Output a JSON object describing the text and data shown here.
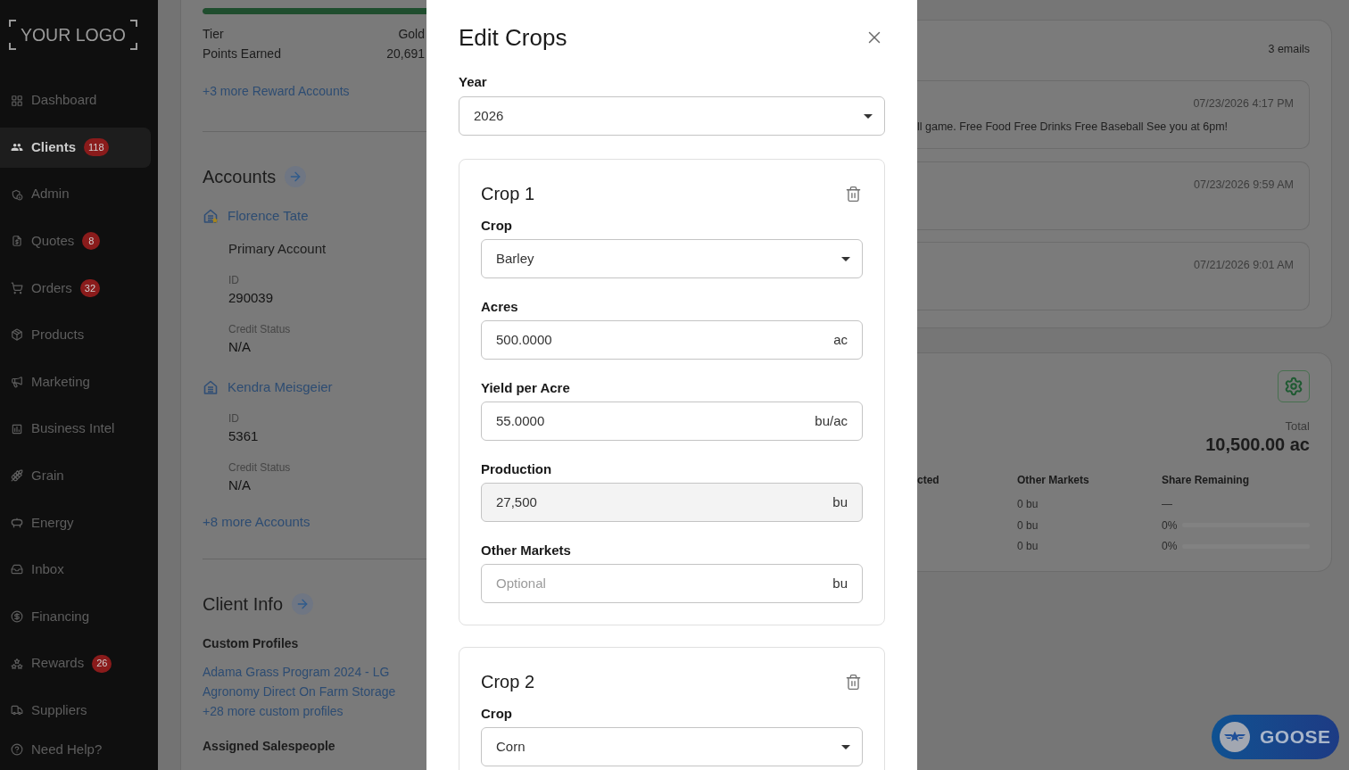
{
  "sidebar": {
    "logo": "YOUR LOGO",
    "items": [
      {
        "label": "Dashboard",
        "selected": false
      },
      {
        "label": "Clients",
        "selected": true,
        "badge": "118"
      },
      {
        "label": "Admin",
        "selected": false
      },
      {
        "label": "Quotes",
        "selected": false,
        "badge": "8"
      },
      {
        "label": "Orders",
        "selected": false,
        "badge": "32"
      },
      {
        "label": "Products",
        "selected": false
      },
      {
        "label": "Marketing",
        "selected": false
      },
      {
        "label": "Business Intel",
        "selected": false
      },
      {
        "label": "Grain",
        "selected": false
      },
      {
        "label": "Energy",
        "selected": false
      },
      {
        "label": "Inbox",
        "selected": false
      },
      {
        "label": "Financing",
        "selected": false
      },
      {
        "label": "Rewards",
        "selected": false,
        "badge": "26"
      },
      {
        "label": "Suppliers",
        "selected": false
      },
      {
        "label": "Need Help?",
        "selected": false
      }
    ]
  },
  "rewards": {
    "progress": {
      "level": 1
    },
    "rows": [
      {
        "label": "Tier",
        "value": "Gold"
      },
      {
        "label": "Points Earned",
        "value": "20,691"
      }
    ],
    "more_link": "+3 more Reward Accounts"
  },
  "accounts": {
    "title": "Accounts",
    "items": [
      {
        "name": "Florence Tate",
        "primary": true,
        "note": "Primary Account",
        "fields": [
          {
            "label": "ID",
            "value": "290039"
          },
          {
            "label": "Credit Status",
            "value": "N/A"
          }
        ]
      },
      {
        "name": "Kendra Meisgeier",
        "primary": false,
        "fields": [
          {
            "label": "ID",
            "value": "5361"
          },
          {
            "label": "Credit Status",
            "value": "N/A"
          }
        ]
      }
    ],
    "more_link": "+8 more Accounts"
  },
  "client_info": {
    "title": "Client Info",
    "custom_profiles": {
      "heading": "Custom Profiles",
      "links": [
        "Adama Grass Program 2024 - LG",
        "Agronomy Direct On Farm Storage",
        "+28 more custom profiles"
      ]
    },
    "assigned_salespeople": {
      "heading": "Assigned Salespeople"
    }
  },
  "modal": {
    "title": "Edit Crops",
    "year": {
      "label": "Year",
      "value": "2026"
    },
    "crops": [
      {
        "title": "Crop 1",
        "fields": [
          {
            "kind": "select",
            "label": "Crop",
            "value": "Barley",
            "disabled": false
          },
          {
            "kind": "input",
            "label": "Acres",
            "value": "500.0000",
            "unit": "ac",
            "disabled": false
          },
          {
            "kind": "input",
            "label": "Yield per Acre",
            "value": "55.0000",
            "unit": "bu/ac",
            "disabled": false
          },
          {
            "kind": "input",
            "label": "Production",
            "value": "27,500",
            "unit": "bu",
            "disabled": true
          },
          {
            "kind": "input",
            "label": "Other Markets",
            "placeholder": "Optional",
            "unit": "bu",
            "disabled": false
          }
        ]
      },
      {
        "title": "Crop 2",
        "fields": [
          {
            "kind": "select",
            "label": "Crop",
            "value": "Corn",
            "disabled": false
          }
        ]
      }
    ]
  },
  "emails": {
    "count": "3 emails",
    "items": [
      {
        "date": "07/23/2026 4:17 PM",
        "preview": "ll game. Free Food Free Drinks Free Baseball See you at 6pm!"
      },
      {
        "date": "07/23/2026 9:59 AM"
      },
      {
        "date": "07/21/2026 9:01 AM"
      }
    ]
  },
  "acreage": {
    "total_label": "Total",
    "total": "10,500.00 ac",
    "table": {
      "columns": [
        "cted",
        "Other Markets",
        "Share Remaining"
      ],
      "rows": [
        {
          "other_markets": "0 bu",
          "share": "—"
        },
        {
          "other_markets": "0 bu",
          "share": "0%",
          "level": 0
        },
        {
          "other_markets": "0 bu",
          "share": "0%",
          "level": 0
        }
      ]
    }
  },
  "assistant_button": {
    "label": "GOOSE"
  }
}
